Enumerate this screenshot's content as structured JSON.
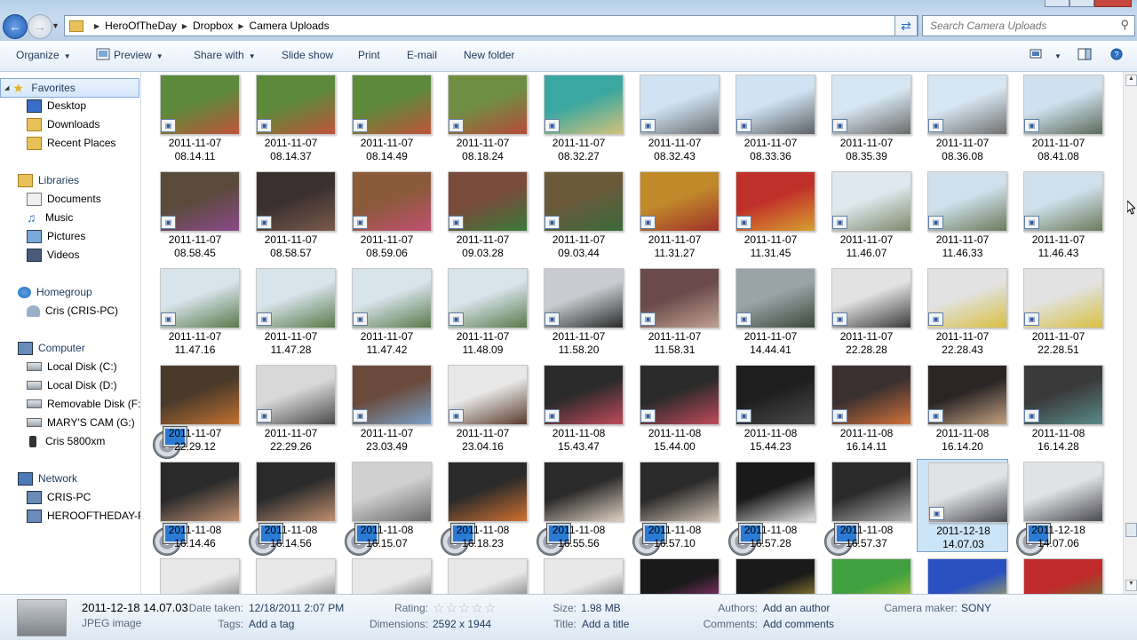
{
  "window": {
    "breadcrumb": [
      "HeroOfTheDay",
      "Dropbox",
      "Camera Uploads"
    ],
    "search_placeholder": "Search Camera Uploads"
  },
  "toolbar": {
    "organize": "Organize",
    "preview": "Preview",
    "share_with": "Share with",
    "slide_show": "Slide show",
    "print": "Print",
    "email": "E-mail",
    "new_folder": "New folder"
  },
  "nav": {
    "favorites": "Favorites",
    "desktop": "Desktop",
    "downloads": "Downloads",
    "recent_places": "Recent Places",
    "libraries": "Libraries",
    "documents": "Documents",
    "music": "Music",
    "pictures": "Pictures",
    "videos": "Videos",
    "homegroup": "Homegroup",
    "cris": "Cris (CRIS-PC)",
    "computer": "Computer",
    "local_c": "Local Disk (C:)",
    "local_d": "Local Disk (D:)",
    "removable_f": "Removable Disk (F:)",
    "marys_cam": "MARY'S CAM (G:)",
    "cris_5800": "Cris 5800xm",
    "network": "Network",
    "cris_pc": "CRIS-PC",
    "herooftheday": "HEROOFTHEDAY-PC"
  },
  "files": [
    {
      "label": "2011-11-07\n08.14.11",
      "kind": "photo",
      "c1": "#5d8a3a",
      "c2": "#c0533a"
    },
    {
      "label": "2011-11-07\n08.14.37",
      "kind": "photo",
      "c1": "#5d8a3a",
      "c2": "#c0533a"
    },
    {
      "label": "2011-11-07\n08.14.49",
      "kind": "photo",
      "c1": "#5d8a3a",
      "c2": "#c0533a"
    },
    {
      "label": "2011-11-07\n08.18.24",
      "kind": "photo",
      "c1": "#6e8f42",
      "c2": "#b84a3a"
    },
    {
      "label": "2011-11-07\n08.32.27",
      "kind": "photo",
      "c1": "#3aa7a0",
      "c2": "#d4c27a"
    },
    {
      "label": "2011-11-07\n08.32.43",
      "kind": "photo",
      "c1": "#cfe3f2",
      "c2": "#6a6e72"
    },
    {
      "label": "2011-11-07\n08.33.36",
      "kind": "photo",
      "c1": "#cfe3f2",
      "c2": "#5d6165"
    },
    {
      "label": "2011-11-07\n08.35.39",
      "kind": "photo",
      "c1": "#d6e6f2",
      "c2": "#6b6b6b"
    },
    {
      "label": "2011-11-07\n08.36.08",
      "kind": "photo",
      "c1": "#d6e6f2",
      "c2": "#707070"
    },
    {
      "label": "2011-11-07\n08.41.08",
      "kind": "photo",
      "c1": "#cfe0ee",
      "c2": "#5b6a5a"
    },
    {
      "label": "2011-11-07\n08.58.45",
      "kind": "photo",
      "c1": "#5a4a3a",
      "c2": "#8a4a8a"
    },
    {
      "label": "2011-11-07\n08.58.57",
      "kind": "photo",
      "c1": "#3a3030",
      "c2": "#7a5a4a"
    },
    {
      "label": "2011-11-07\n08.59.06",
      "kind": "photo",
      "c1": "#8a5a3a",
      "c2": "#c05070"
    },
    {
      "label": "2011-11-07\n09.03.28",
      "kind": "photo",
      "c1": "#7a4a3a",
      "c2": "#3a7a3a"
    },
    {
      "label": "2011-11-07\n09.03.44",
      "kind": "photo",
      "c1": "#6a5a3a",
      "c2": "#3a6a3a"
    },
    {
      "label": "2011-11-07\n11.31.27",
      "kind": "photo",
      "c1": "#c08a2a",
      "c2": "#a0302a"
    },
    {
      "label": "2011-11-07\n11.31.45",
      "kind": "photo",
      "c1": "#c0302a",
      "c2": "#d8a030"
    },
    {
      "label": "2011-11-07\n11.46.07",
      "kind": "photo",
      "c1": "#dfe8ee",
      "c2": "#7d8a6a"
    },
    {
      "label": "2011-11-07\n11.46.33",
      "kind": "photo",
      "c1": "#cfe0ec",
      "c2": "#6a7a5a"
    },
    {
      "label": "2011-11-07\n11.46.43",
      "kind": "photo",
      "c1": "#cfe0ec",
      "c2": "#6a7a5a"
    },
    {
      "label": "2011-11-07\n11.47.16",
      "kind": "photo",
      "c1": "#d8e4ec",
      "c2": "#5a7a4a"
    },
    {
      "label": "2011-11-07\n11.47.28",
      "kind": "photo",
      "c1": "#d8e4ec",
      "c2": "#5a7a4a"
    },
    {
      "label": "2011-11-07\n11.47.42",
      "kind": "photo",
      "c1": "#d8e4ec",
      "c2": "#5a7a4a"
    },
    {
      "label": "2011-11-07\n11.48.09",
      "kind": "photo",
      "c1": "#d8e4ec",
      "c2": "#5a7a4a"
    },
    {
      "label": "2011-11-07\n11.58.20",
      "kind": "photo",
      "c1": "#c8ccd0",
      "c2": "#2a2a2a"
    },
    {
      "label": "2011-11-07\n11.58.31",
      "kind": "photo",
      "c1": "#6a4a4a",
      "c2": "#c0a090"
    },
    {
      "label": "2011-11-07\n14.44.41",
      "kind": "photo",
      "c1": "#9aa4a8",
      "c2": "#3a4a3a"
    },
    {
      "label": "2011-11-07\n22.28.28",
      "kind": "photo",
      "c1": "#e2e2e2",
      "c2": "#3a3a3a"
    },
    {
      "label": "2011-11-07\n22.28.43",
      "kind": "photo",
      "c1": "#e2e2e2",
      "c2": "#d8c040"
    },
    {
      "label": "2011-11-07\n22.28.51",
      "kind": "photo",
      "c1": "#e2e2e2",
      "c2": "#d8c040"
    },
    {
      "label": "2011-11-07\n22.29.12",
      "kind": "video",
      "c1": "#4a3a2a",
      "c2": "#c07030"
    },
    {
      "label": "2011-11-07\n22.29.26",
      "kind": "photo",
      "c1": "#d8d8d8",
      "c2": "#4a4a4a"
    },
    {
      "label": "2011-11-07\n23.03.49",
      "kind": "photo",
      "c1": "#6a4a3a",
      "c2": "#7aa0c8"
    },
    {
      "label": "2011-11-07\n23.04.16",
      "kind": "photo",
      "c1": "#e8e8e8",
      "c2": "#5a3a2a"
    },
    {
      "label": "2011-11-08\n15.43.47",
      "kind": "photo",
      "c1": "#2a2a2a",
      "c2": "#c04a5a"
    },
    {
      "label": "2011-11-08\n15.44.00",
      "kind": "photo",
      "c1": "#2a2a2a",
      "c2": "#c04a5a"
    },
    {
      "label": "2011-11-08\n15.44.23",
      "kind": "photo",
      "c1": "#1e1e1e",
      "c2": "#4a4a4a"
    },
    {
      "label": "2011-11-08\n16.14.11",
      "kind": "photo",
      "c1": "#3a3030",
      "c2": "#d0703a"
    },
    {
      "label": "2011-11-08\n16.14.20",
      "kind": "photo",
      "c1": "#2a2424",
      "c2": "#c0a080"
    },
    {
      "label": "2011-11-08\n16.14.28",
      "kind": "photo",
      "c1": "#3a3a3a",
      "c2": "#5a8a8a"
    },
    {
      "label": "2011-11-08\n16.14.46",
      "kind": "video",
      "c1": "#2a2a2a",
      "c2": "#c09070"
    },
    {
      "label": "2011-11-08\n16.14.56",
      "kind": "video",
      "c1": "#2a2a2a",
      "c2": "#c09070"
    },
    {
      "label": "2011-11-08\n16.15.07",
      "kind": "video",
      "c1": "#d0d0d0",
      "c2": "#6a6a6a"
    },
    {
      "label": "2011-11-08\n16.18.23",
      "kind": "video",
      "c1": "#2a2a2a",
      "c2": "#d07030"
    },
    {
      "label": "2011-11-08\n16.55.56",
      "kind": "video",
      "c1": "#2a2a2a",
      "c2": "#e0d0c0"
    },
    {
      "label": "2011-11-08\n16.57.10",
      "kind": "video",
      "c1": "#2a2a2a",
      "c2": "#d0c0b0"
    },
    {
      "label": "2011-11-08\n16.57.28",
      "kind": "video",
      "c1": "#1a1a1a",
      "c2": "#e0e0e0"
    },
    {
      "label": "2011-11-08\n16.57.37",
      "kind": "video",
      "c1": "#2a2a2a",
      "c2": "#b0b0b0"
    },
    {
      "label": "2011-12-18\n14.07.03",
      "kind": "photo",
      "c1": "#e0e2e4",
      "c2": "#4a4a52",
      "selected": true
    },
    {
      "label": "2011-12-18\n14.07.06",
      "kind": "video",
      "c1": "#e0e2e4",
      "c2": "#4a4a52"
    },
    {
      "label": "",
      "kind": "photo",
      "c1": "#e8e8e8",
      "c2": "#4a4a4a"
    },
    {
      "label": "",
      "kind": "video",
      "c1": "#e8e8e8",
      "c2": "#4a4a4a"
    },
    {
      "label": "",
      "kind": "video",
      "c1": "#e8e8e8",
      "c2": "#4a4a4a"
    },
    {
      "label": "",
      "kind": "photo",
      "c1": "#e8e8e8",
      "c2": "#4a4a4a"
    },
    {
      "label": "",
      "kind": "photo",
      "c1": "#e8e8e8",
      "c2": "#4a4a4a"
    },
    {
      "label": "",
      "kind": "video",
      "c1": "#1a1a1a",
      "c2": "#d040a0"
    },
    {
      "label": "",
      "kind": "video",
      "c1": "#1a1a1a",
      "c2": "#e0c040"
    },
    {
      "label": "",
      "kind": "photo",
      "c1": "#40a040",
      "c2": "#e0d030"
    },
    {
      "label": "",
      "kind": "video",
      "c1": "#2a50c0",
      "c2": "#e0d030"
    },
    {
      "label": "",
      "kind": "video",
      "c1": "#c02a2a",
      "c2": "#40a040"
    }
  ],
  "details": {
    "name": "2011-12-18 14.07.03",
    "type": "JPEG image",
    "date_taken_label": "Date taken:",
    "date_taken": "12/18/2011 2:07 PM",
    "tags_label": "Tags:",
    "tags": "Add a tag",
    "rating_label": "Rating:",
    "rating": 0,
    "dimensions_label": "Dimensions:",
    "dimensions": "2592 x 1944",
    "size_label": "Size:",
    "size": "1.98 MB",
    "title_label": "Title:",
    "title": "Add a title",
    "authors_label": "Authors:",
    "authors": "Add an author",
    "comments_label": "Comments:",
    "comments": "Add comments",
    "camera_label": "Camera maker:",
    "camera": "SONY"
  }
}
